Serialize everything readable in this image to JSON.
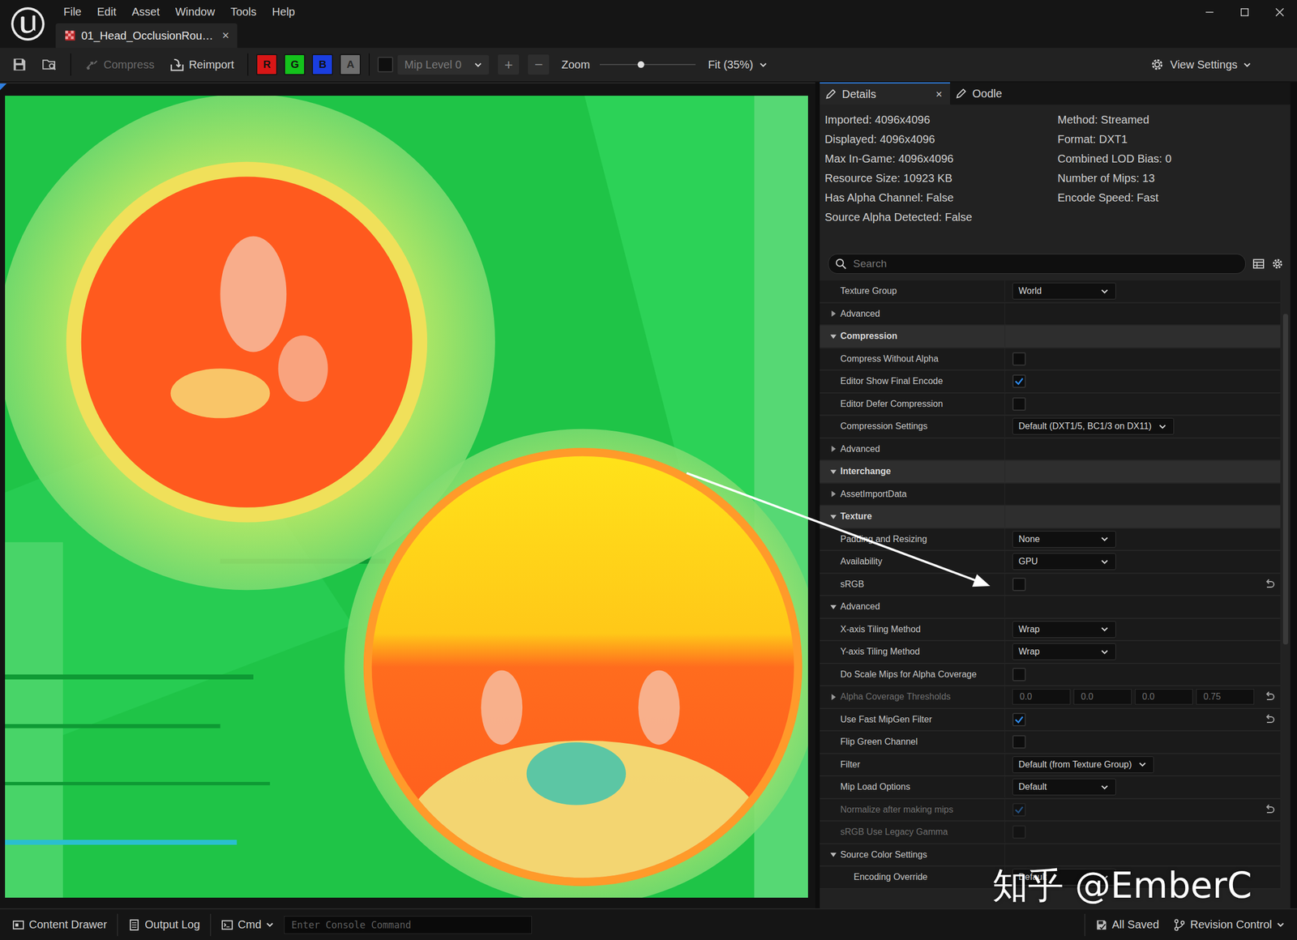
{
  "window": {
    "menu": [
      "File",
      "Edit",
      "Asset",
      "Window",
      "Tools",
      "Help"
    ],
    "document_tab": {
      "label": "01_Head_OcclusionRou…",
      "close": "×",
      "selected": true
    }
  },
  "toolbar": {
    "compress": {
      "label": "Compress",
      "disabled": true
    },
    "reimport": {
      "label": "Reimport",
      "disabled": false
    },
    "channels": [
      {
        "label": "R",
        "on": true,
        "color": "#d81616"
      },
      {
        "label": "G",
        "on": true,
        "color": "#14c21c"
      },
      {
        "label": "B",
        "on": true,
        "color": "#1a3ee0"
      },
      {
        "label": "A",
        "on": false,
        "color": "#6e6e6e"
      }
    ],
    "mip_checkbox": {
      "checked": false
    },
    "mip_level": {
      "label": "Mip Level 0",
      "disabled": true
    },
    "zoom_in": "+",
    "zoom_out": "−",
    "zoom_label": "Zoom",
    "zoom": {
      "level": 0.43
    },
    "fit": "Fit (35%)",
    "view_settings": "View Settings"
  },
  "details": {
    "tabs": [
      {
        "label": "Details",
        "selected": true,
        "close": "×"
      },
      {
        "label": "Oodle",
        "selected": false,
        "close": ""
      }
    ],
    "info_left": [
      "Imported: 4096x4096",
      "Displayed: 4096x4096",
      "Max In-Game: 4096x4096",
      "Resource Size: 10923 KB",
      "Has Alpha Channel: False",
      "Source Alpha Detected: False"
    ],
    "info_right": [
      "Method: Streamed",
      "Format: DXT1",
      "Combined LOD Bias: 0",
      "Number of Mips: 13",
      "Encode Speed: Fast"
    ],
    "search": {
      "placeholder": "Search"
    },
    "rows": [
      {
        "kind": "dropdown",
        "label": "Texture Group",
        "value": "World",
        "depth": 0,
        "disabled": false,
        "reset": false
      },
      {
        "kind": "group",
        "label": "Advanced",
        "expanded": false,
        "depth": 0,
        "disabled": false,
        "reset": false
      },
      {
        "kind": "category",
        "label": "Compression",
        "expanded": true,
        "depth": 0,
        "disabled": false,
        "reset": false
      },
      {
        "kind": "checkbox",
        "label": "Compress Without Alpha",
        "checked": false,
        "depth": 0,
        "disabled": false,
        "reset": false
      },
      {
        "kind": "checkbox",
        "label": "Editor Show Final Encode",
        "checked": true,
        "depth": 0,
        "disabled": false,
        "reset": false
      },
      {
        "kind": "checkbox",
        "label": "Editor Defer Compression",
        "checked": false,
        "depth": 0,
        "disabled": false,
        "reset": false
      },
      {
        "kind": "dropdown",
        "label": "Compression Settings",
        "value": "Default (DXT1/5, BC1/3 on DX11)",
        "depth": 0,
        "disabled": false,
        "reset": false
      },
      {
        "kind": "group",
        "label": "Advanced",
        "expanded": false,
        "depth": 0,
        "disabled": false,
        "reset": false
      },
      {
        "kind": "category",
        "label": "Interchange",
        "expanded": true,
        "depth": 0,
        "disabled": false,
        "reset": false
      },
      {
        "kind": "group",
        "label": "AssetImportData",
        "expanded": false,
        "depth": 0,
        "disabled": false,
        "reset": false
      },
      {
        "kind": "category",
        "label": "Texture",
        "expanded": true,
        "depth": 0,
        "disabled": false,
        "reset": false
      },
      {
        "kind": "dropdown",
        "label": "Padding and Resizing",
        "value": "None",
        "depth": 0,
        "disabled": false,
        "reset": false
      },
      {
        "kind": "dropdown",
        "label": "Availability",
        "value": "GPU",
        "depth": 0,
        "disabled": false,
        "reset": false
      },
      {
        "kind": "checkbox",
        "label": "sRGB",
        "checked": false,
        "depth": 0,
        "disabled": false,
        "reset": true
      },
      {
        "kind": "group",
        "label": "Advanced",
        "expanded": true,
        "depth": 0,
        "disabled": false,
        "reset": false
      },
      {
        "kind": "dropdown",
        "label": "X-axis Tiling Method",
        "value": "Wrap",
        "depth": 0,
        "disabled": false,
        "reset": false
      },
      {
        "kind": "dropdown",
        "label": "Y-axis Tiling Method",
        "value": "Wrap",
        "depth": 0,
        "disabled": false,
        "reset": false
      },
      {
        "kind": "checkbox",
        "label": "Do Scale Mips for Alpha Coverage",
        "checked": false,
        "depth": 0,
        "disabled": false,
        "reset": false
      },
      {
        "kind": "vector",
        "label": "Alpha Coverage Thresholds",
        "values": [
          "0.0",
          "0.0",
          "0.0",
          "0.75"
        ],
        "expanded": false,
        "depth": 0,
        "disabled": true,
        "reset": true
      },
      {
        "kind": "checkbox",
        "label": "Use Fast MipGen Filter",
        "checked": true,
        "depth": 0,
        "disabled": false,
        "reset": true
      },
      {
        "kind": "checkbox",
        "label": "Flip Green Channel",
        "checked": false,
        "depth": 0,
        "disabled": false,
        "reset": false
      },
      {
        "kind": "dropdown",
        "label": "Filter",
        "value": "Default (from Texture Group)",
        "depth": 0,
        "disabled": false,
        "reset": false
      },
      {
        "kind": "dropdown",
        "label": "Mip Load Options",
        "value": "Default",
        "depth": 0,
        "disabled": false,
        "reset": false
      },
      {
        "kind": "checkbox",
        "label": "Normalize after making mips",
        "checked": true,
        "depth": 0,
        "disabled": true,
        "reset": true
      },
      {
        "kind": "checkbox",
        "label": "sRGB Use Legacy Gamma",
        "checked": false,
        "depth": 0,
        "disabled": true,
        "reset": false
      },
      {
        "kind": "group",
        "label": "Source Color Settings",
        "expanded": true,
        "depth": 0,
        "disabled": false,
        "reset": false
      },
      {
        "kind": "dropdown",
        "label": "Encoding Override",
        "value": "Default",
        "depth": 1,
        "disabled": false,
        "reset": false
      }
    ]
  },
  "status_bar": {
    "content_drawer": "Content Drawer",
    "output_log": "Output Log",
    "cmd": "Cmd",
    "console_placeholder": "Enter Console Command",
    "all_saved": "All Saved",
    "revision_control": "Revision Control"
  },
  "watermark": "知乎 @EmberC"
}
